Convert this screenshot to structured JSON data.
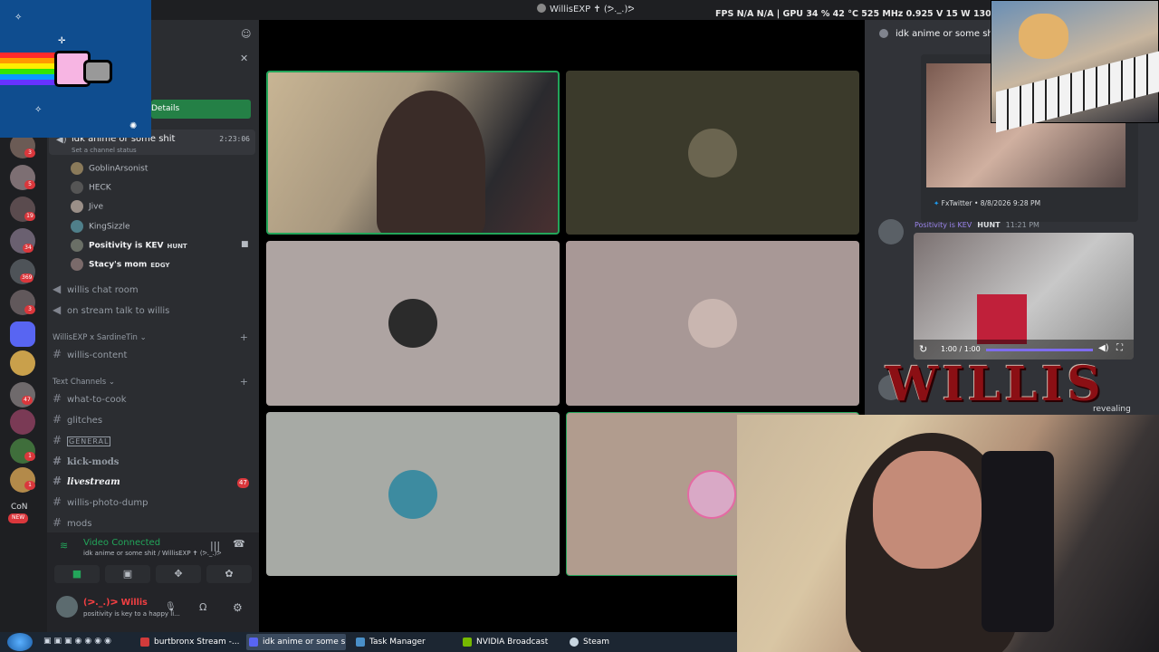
{
  "window": {
    "title": "WillisEXP ✝ (ᕗ._.)ᕗ",
    "osd": "FPS  N/A  N/A  |  GPU 34 % 42 °C 525 MHz 0.925 V 15 W 1300 RPM"
  },
  "sidebar": {
    "details_label": "Details",
    "voice_channel": {
      "name": "idk anime or some shit",
      "elapsed": "2:23:06",
      "status_placeholder": "Set a channel status"
    },
    "voice_users": [
      {
        "name": "GoblinArsonist"
      },
      {
        "name": "HECK"
      },
      {
        "name": "Jive"
      },
      {
        "name": "KingSizzle"
      },
      {
        "name": "Positivity is KEV",
        "tag": "HUNT"
      },
      {
        "name": "Stacy's mom",
        "tag": "EDGY"
      }
    ],
    "voice_channels_other": [
      "willis chat room",
      "on stream talk to willis"
    ],
    "category_collab": "WillisEXP x SardineTin",
    "collab_channels": [
      "willis-content"
    ],
    "category_text": "Text Channels",
    "text_channels": [
      {
        "name": "what-to-cook"
      },
      {
        "name": "glitches"
      },
      {
        "name": "GENERAL"
      },
      {
        "name": "kick-mods"
      },
      {
        "name": "livestream",
        "badge": "47"
      },
      {
        "name": "willis-photo-dump"
      },
      {
        "name": "mods"
      }
    ]
  },
  "server_rail": {
    "badges": [
      "3",
      "5",
      "19",
      "34",
      "369",
      "3",
      "47",
      "1",
      "1"
    ],
    "new_label": "NEW",
    "con_label": "CoN"
  },
  "voice_panel": {
    "status": "Video Connected",
    "location": "idk anime or some shit / WillisEXP ✝ (ᕗ._.)ᕗ",
    "user_name": "(ᕗ._.)ᕗ Willis",
    "user_status": "positivity is key to a happy li..."
  },
  "chat": {
    "channel_title": "idk anime or some shit",
    "embed_footer": "FxTwitter • 8/8/2026 9:28 PM",
    "msg_author": "Positivity is KEV",
    "msg_tag": "HUNT",
    "msg_time": "11:21 PM",
    "player_time": "1:00 / 1:00",
    "last_msg": "revealing"
  },
  "overlay": {
    "logo_text": "WILLIS"
  },
  "taskbar": {
    "items": [
      "burtbronx Stream -...",
      "idk anime or some s...",
      "Task Manager",
      "NVIDIA Broadcast",
      "Steam"
    ]
  }
}
